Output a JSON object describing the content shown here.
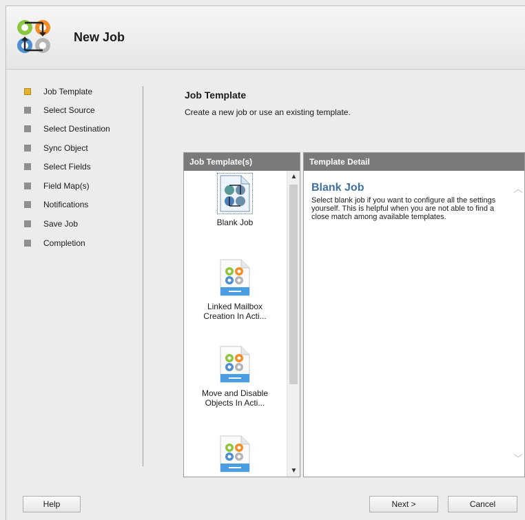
{
  "header": {
    "title": "New Job",
    "icon": "job-logo-icon"
  },
  "nav": {
    "items": [
      {
        "label": "Job Template",
        "active": true
      },
      {
        "label": "Select Source",
        "active": false
      },
      {
        "label": "Select Destination",
        "active": false
      },
      {
        "label": "Sync Object",
        "active": false
      },
      {
        "label": "Select Fields",
        "active": false
      },
      {
        "label": "Field Map(s)",
        "active": false
      },
      {
        "label": "Notifications",
        "active": false
      },
      {
        "label": "Save Job",
        "active": false
      },
      {
        "label": "Completion",
        "active": false
      }
    ]
  },
  "content": {
    "title": "Job Template",
    "description": "Create a new job or use an existing template."
  },
  "templates_panel": {
    "header": "Job Template(s)",
    "items": [
      {
        "label_line1": "Blank Job",
        "label_line2": "",
        "selected": true
      },
      {
        "label_line1": "Linked Mailbox",
        "label_line2": "Creation In Acti...",
        "selected": false
      },
      {
        "label_line1": "Move and Disable",
        "label_line2": "Objects In Acti...",
        "selected": false
      },
      {
        "label_line1": "",
        "label_line2": "",
        "selected": false
      }
    ]
  },
  "detail_panel": {
    "header": "Template Detail",
    "title": "Blank Job",
    "text": "Select blank job if you want to configure all the settings yourself. This is helpful when you are not able to find a close match among available templates."
  },
  "buttons": {
    "help": "Help",
    "next": "Next >",
    "cancel": "Cancel"
  },
  "colors": {
    "accent": "#3f6f9e",
    "active_bullet": "#e5b12f",
    "panel_header": "#7a7a7a"
  }
}
